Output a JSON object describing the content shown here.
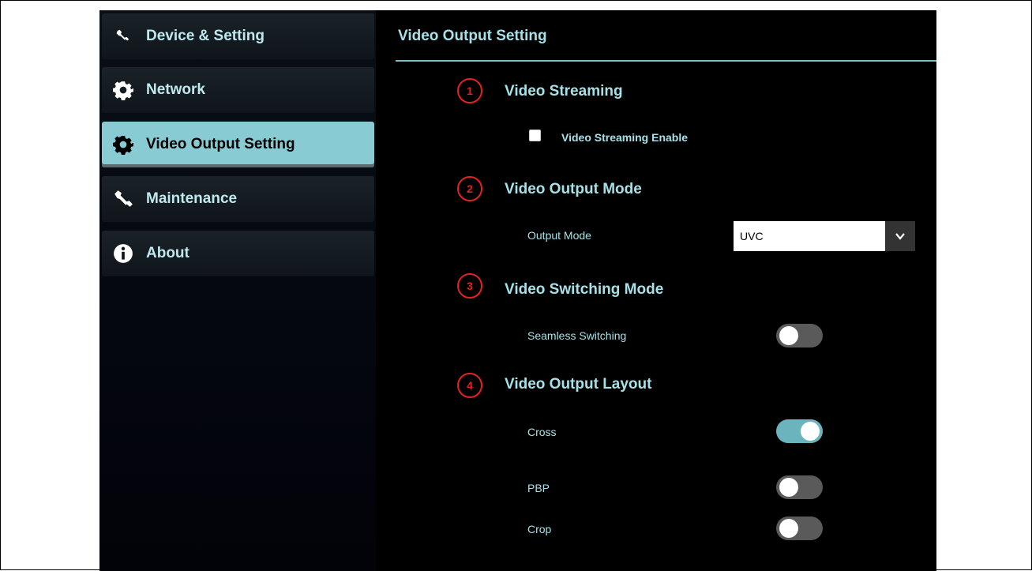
{
  "sidebar": {
    "items": [
      {
        "label": "Device & Setting",
        "icon": "wrench-icon"
      },
      {
        "label": "Network",
        "icon": "gear-icon"
      },
      {
        "label": "Video Output Setting",
        "icon": "gear-icon",
        "active": true
      },
      {
        "label": "Maintenance",
        "icon": "wrench-icon"
      },
      {
        "label": "About",
        "icon": "info-icon"
      }
    ]
  },
  "main": {
    "title": "Video Output Setting",
    "sections": [
      {
        "number": "1",
        "title": "Video Streaming"
      },
      {
        "number": "2",
        "title": "Video Output Mode"
      },
      {
        "number": "3",
        "title": "Video Switching Mode"
      },
      {
        "number": "4",
        "title": "Video Output Layout"
      }
    ],
    "streaming": {
      "checkbox_label": "Video Streaming Enable",
      "checked": false
    },
    "output_mode": {
      "label": "Output Mode",
      "value": "UVC"
    },
    "switching": {
      "label": "Seamless Switching",
      "enabled": false
    },
    "layout": {
      "options": [
        {
          "label": "Cross",
          "enabled": true
        },
        {
          "label": "PBP",
          "enabled": false
        },
        {
          "label": "Crop",
          "enabled": false
        }
      ]
    }
  },
  "colors": {
    "accent": "#89cbd3",
    "text": "#a7e1e8",
    "marker": "#e52222",
    "toggle_on": "#6bb3bd",
    "toggle_off": "#5a5a5a"
  }
}
